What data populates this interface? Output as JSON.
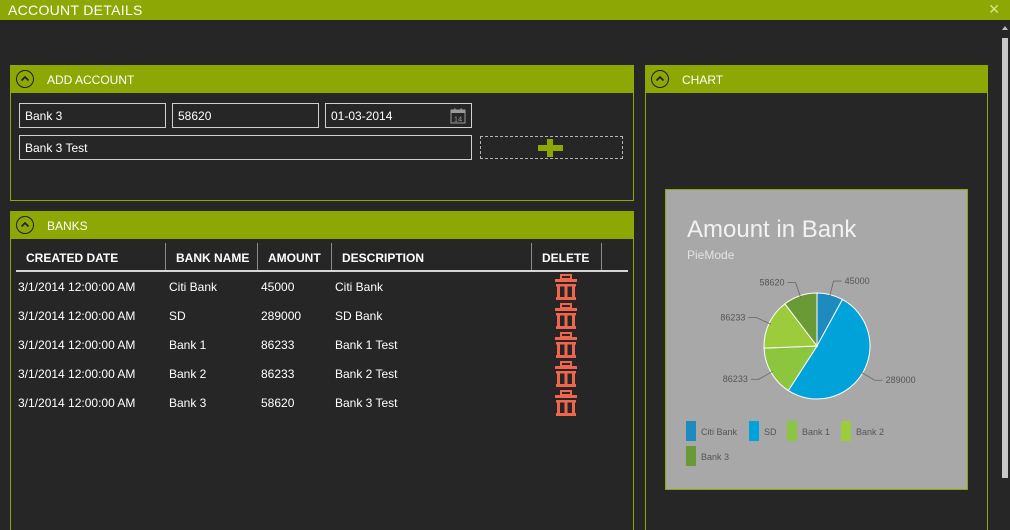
{
  "window": {
    "title": "ACCOUNT DETAILS",
    "close_glyph": "✕"
  },
  "add_account": {
    "title": "ADD ACCOUNT",
    "bank_name": "Bank 3",
    "amount": "58620",
    "date": "01-03-2014",
    "calendar_day": "14",
    "description": "Bank 3 Test"
  },
  "banks": {
    "title": "BANKS",
    "columns": [
      "CREATED DATE",
      "BANK NAME",
      "AMOUNT",
      "DESCRIPTION",
      "DELETE"
    ],
    "rows": [
      {
        "created": "3/1/2014 12:00:00 AM",
        "bank": "Citi Bank",
        "amount": "45000",
        "description": "Citi Bank"
      },
      {
        "created": "3/1/2014 12:00:00 AM",
        "bank": "SD",
        "amount": "289000",
        "description": "SD Bank"
      },
      {
        "created": "3/1/2014 12:00:00 AM",
        "bank": "Bank 1",
        "amount": "86233",
        "description": "Bank 1 Test"
      },
      {
        "created": "3/1/2014 12:00:00 AM",
        "bank": "Bank 2",
        "amount": "86233",
        "description": "Bank 2 Test"
      },
      {
        "created": "3/1/2014 12:00:00 AM",
        "bank": "Bank 3",
        "amount": "58620",
        "description": "Bank 3 Test"
      }
    ]
  },
  "chart_panel": {
    "title": "CHART"
  },
  "chart_data": {
    "type": "pie",
    "title": "Amount in Bank",
    "subtitle": "PieMode",
    "slices": [
      {
        "label": "Citi Bank",
        "value": 45000,
        "color": "#1e8bbf"
      },
      {
        "label": "SD",
        "value": 289000,
        "color": "#00a3d9"
      },
      {
        "label": "Bank 1",
        "value": 86233,
        "color": "#8cc63f"
      },
      {
        "label": "Bank 2",
        "value": 86233,
        "color": "#9ccc3c"
      },
      {
        "label": "Bank 3",
        "value": 58620,
        "color": "#6a9a35"
      }
    ],
    "legend_position": "bottom"
  },
  "colors": {
    "accent": "#8da705",
    "background": "#262626",
    "delete": "#f0654e"
  },
  "icons": {
    "collapse": "chevron-up-circle-icon",
    "calendar": "calendar-icon",
    "add": "plus-icon",
    "delete": "trash-icon"
  }
}
